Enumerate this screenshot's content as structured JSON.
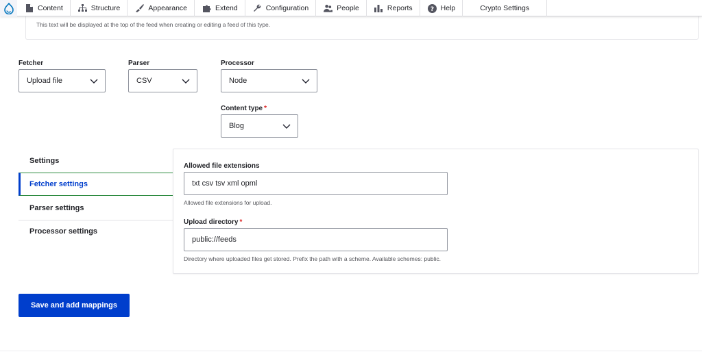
{
  "toolbar": {
    "logo_icon": "drupal-drop-icon",
    "items": [
      {
        "label": "Content",
        "icon": "file-icon"
      },
      {
        "label": "Structure",
        "icon": "sitemap-icon"
      },
      {
        "label": "Appearance",
        "icon": "paint-brush-icon"
      },
      {
        "label": "Extend",
        "icon": "puzzle-icon"
      },
      {
        "label": "Configuration",
        "icon": "wrench-icon"
      },
      {
        "label": "People",
        "icon": "people-icon"
      },
      {
        "label": "Reports",
        "icon": "bar-chart-icon"
      },
      {
        "label": "Help",
        "icon": "help-icon"
      }
    ],
    "extra_item": "Crypto Settings"
  },
  "description_text": "This text will be displayed at the top of the feed when creating or editing a feed of this type.",
  "plugins": {
    "fetcher": {
      "label": "Fetcher",
      "value": "Upload file"
    },
    "parser": {
      "label": "Parser",
      "value": "CSV"
    },
    "processor": {
      "label": "Processor",
      "value": "Node"
    },
    "content_type": {
      "label": "Content type",
      "required_mark": "*",
      "value": "Blog"
    }
  },
  "vertical_tabs": [
    {
      "label": "Settings",
      "active": false
    },
    {
      "label": "Fetcher settings",
      "active": true
    },
    {
      "label": "Parser settings",
      "active": false
    },
    {
      "label": "Processor settings",
      "active": false
    }
  ],
  "fetcher_settings": {
    "allowed_extensions": {
      "label": "Allowed file extensions",
      "value": "txt csv tsv xml opml",
      "hint": "Allowed file extensions for upload."
    },
    "upload_directory": {
      "label": "Upload directory",
      "required_mark": "*",
      "value": "public://feeds",
      "hint": "Directory where uploaded files get stored. Prefix the path with a scheme. Available schemes: public."
    }
  },
  "actions": {
    "save_label": "Save and add mappings"
  },
  "colors": {
    "primary": "#003ecc",
    "required": "#dc2323",
    "drupal_blue": "#0678be"
  }
}
